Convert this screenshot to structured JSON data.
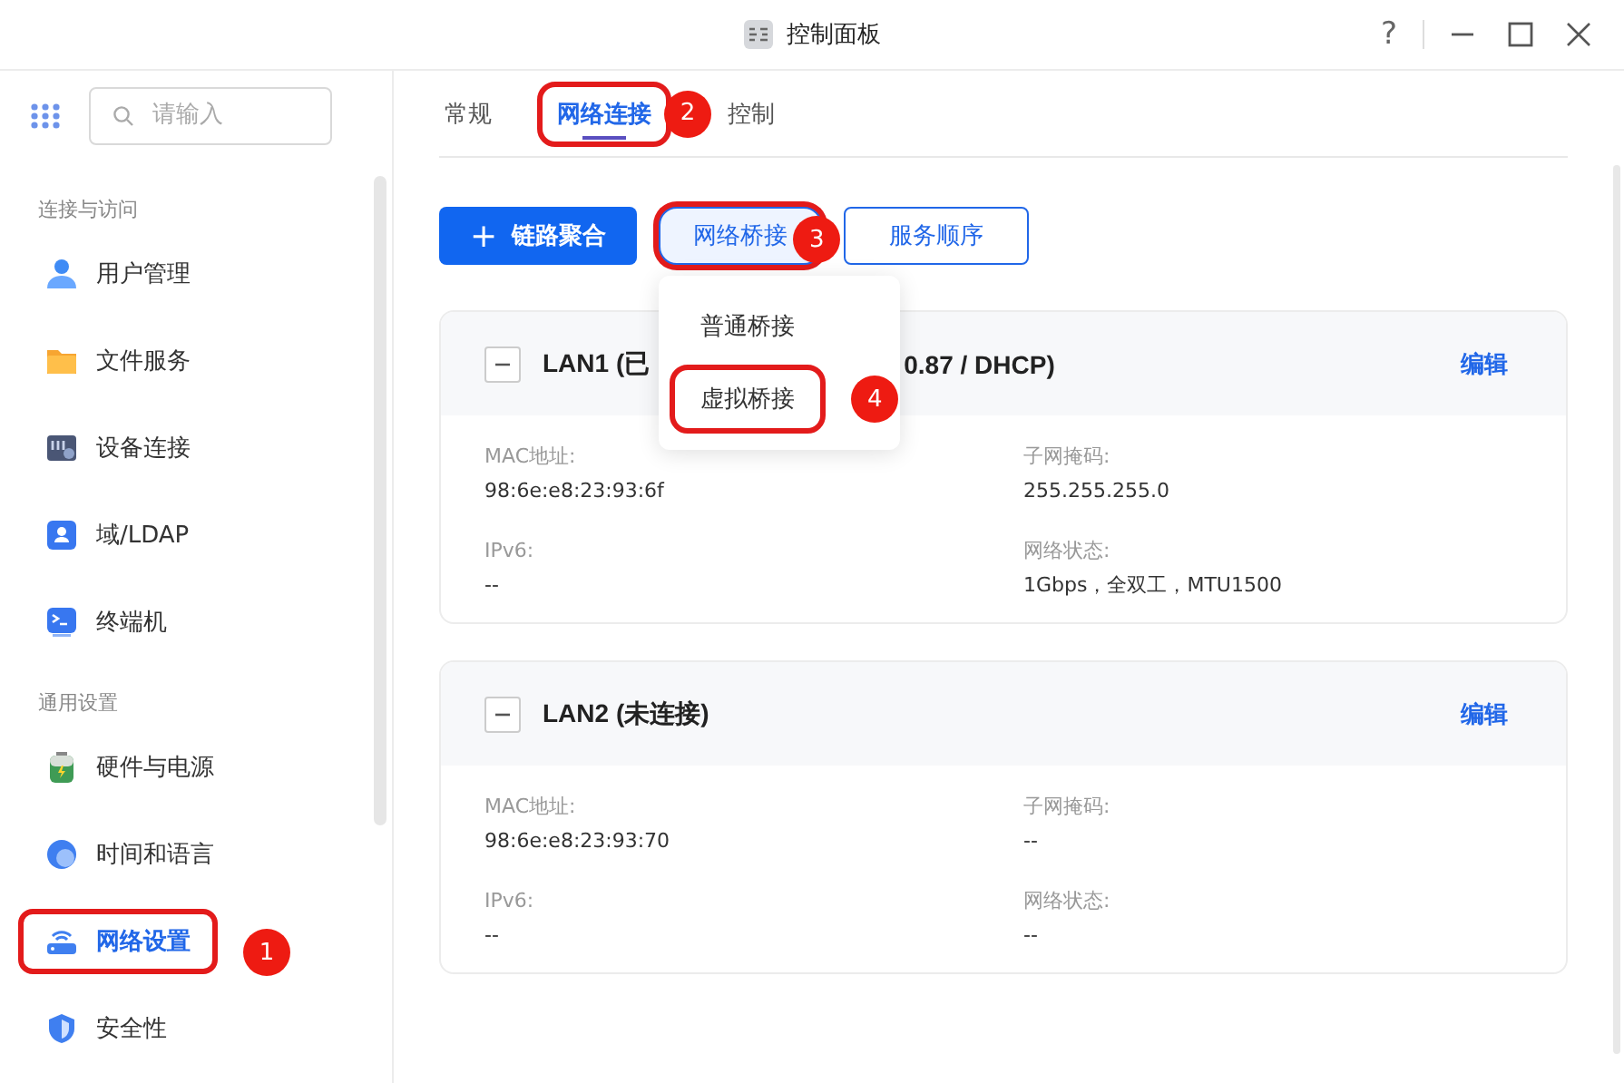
{
  "window": {
    "title": "控制面板",
    "help": "?"
  },
  "search": {
    "placeholder": "请输入"
  },
  "sidebar": {
    "sections": [
      {
        "label": "连接与访问",
        "items": [
          {
            "label": "用户管理",
            "kind": "user",
            "selected": false
          },
          {
            "label": "文件服务",
            "kind": "folder",
            "selected": false
          },
          {
            "label": "设备连接",
            "kind": "device",
            "selected": false
          },
          {
            "label": "域/LDAP",
            "kind": "ldap",
            "selected": false
          },
          {
            "label": "终端机",
            "kind": "terminal",
            "selected": false
          }
        ]
      },
      {
        "label": "通用设置",
        "items": [
          {
            "label": "硬件与电源",
            "kind": "hardware",
            "selected": false
          },
          {
            "label": "时间和语言",
            "kind": "globe",
            "selected": false
          },
          {
            "label": "网络设置",
            "kind": "network",
            "selected": true,
            "highlight": true,
            "marker": "1"
          },
          {
            "label": "安全性",
            "kind": "shield",
            "selected": false
          }
        ]
      }
    ]
  },
  "tabs": [
    {
      "label": "常规",
      "selected": false
    },
    {
      "label": "网络连接",
      "selected": true,
      "highlight": true,
      "marker": "2"
    },
    {
      "label": "控制",
      "selected": false
    }
  ],
  "toolbar": [
    {
      "label": "链路聚合",
      "kind": "primary",
      "icon": "+"
    },
    {
      "label": "网络桥接",
      "kind": "dropdown",
      "expanded": true,
      "highlight": true,
      "marker": "3"
    },
    {
      "label": "服务顺序",
      "kind": "outline"
    }
  ],
  "dropdown": [
    {
      "label": "普通桥接",
      "highlight": false
    },
    {
      "label": "虚拟桥接",
      "highlight": true,
      "marker": "4"
    }
  ],
  "lans": [
    {
      "title": "LAN1 (已",
      "title_tail": "0.87 / DHCP)",
      "edit": "编辑",
      "expanded": true,
      "fields": [
        {
          "label": "MAC地址:",
          "value": "98:6e:e8:23:93:6f"
        },
        {
          "label": "子网掩码:",
          "value": "255.255.255.0"
        },
        {
          "label": "IPv6:",
          "value": "--"
        },
        {
          "label": "网络状态:",
          "value": "1Gbps，全双工，MTU1500"
        }
      ]
    },
    {
      "title": "LAN2 (未连接)",
      "edit": "编辑",
      "expanded": true,
      "fields": [
        {
          "label": "MAC地址:",
          "value": "98:6e:e8:23:93:70"
        },
        {
          "label": "子网掩码:",
          "value": "--"
        },
        {
          "label": "IPv6:",
          "value": "--"
        },
        {
          "label": "网络状态:",
          "value": "--"
        }
      ]
    }
  ]
}
